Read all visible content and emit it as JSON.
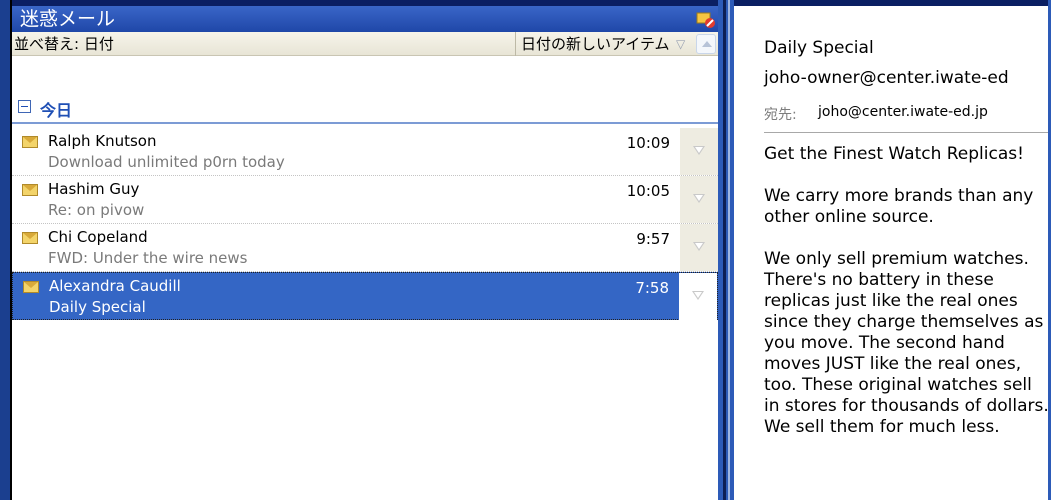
{
  "list_pane": {
    "title": "迷惑メール",
    "sort_label": "並べ替え: 日付",
    "sort_order": "日付の新しいアイテム",
    "group_label": "今日",
    "messages": [
      {
        "sender": "Ralph Knutson",
        "subject": "Download unlimited p0rn today",
        "time": "10:09",
        "selected": false
      },
      {
        "sender": "Hashim Guy",
        "subject": "Re: on pivow",
        "time": "10:05",
        "selected": false
      },
      {
        "sender": "Chi Copeland",
        "subject": "FWD: Under the wire news",
        "time": "9:57",
        "selected": false
      },
      {
        "sender": "Alexandra Caudill",
        "subject": "Daily Special",
        "time": "7:58",
        "selected": true
      }
    ]
  },
  "reading_pane": {
    "subject": "Daily Special",
    "from": "joho-owner@center.iwate-ed",
    "to_label": "宛先:",
    "to": "joho@center.iwate-ed.jp",
    "body": [
      "Get the Finest Watch Replicas!",
      "We carry more brands than any other online source.",
      "We only sell premium watches. There's no battery in these replicas just like the real ones since they charge themselves as you move. The second hand moves JUST like the real ones, too. These original watches sell in stores for thousands of dollars. We sell them for much less."
    ]
  },
  "colors": {
    "selection": "#3466c5",
    "header": "#1f47a8",
    "group_text": "#1f4fb5"
  },
  "icons": {
    "folder": "junk-folder-icon",
    "message": "envelope-icon",
    "flag": "flag-icon"
  }
}
